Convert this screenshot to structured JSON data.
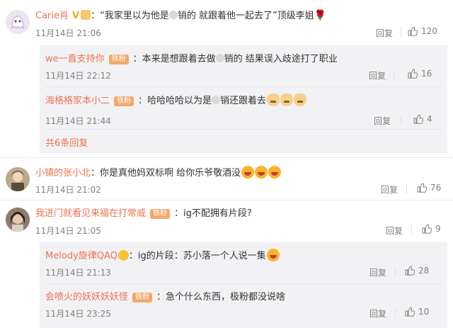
{
  "comments": [
    {
      "user": "Carie肖",
      "text_before": "：“我家里以为他是",
      "text_after": "销的 就跟着他一起去了”顶级李姐",
      "time": "11月14日 21:06",
      "reply_label": "回复",
      "likes": "120",
      "replies": [
        {
          "user": "we一直支持你",
          "badge": "铁粉",
          "text_before": "：本来是想跟着去做",
          "text_after": "销的 结果误入歧途打了职业",
          "time": "11月14日 22:12",
          "reply_label": "回复",
          "likes": "16"
        },
        {
          "user": "海格格家本小二",
          "badge": "铁粉",
          "text_before": "：哈哈哈哈以为是",
          "text_after": "销还跟着去",
          "time": "11月14日 21:44",
          "reply_label": "回复",
          "likes": "4"
        }
      ],
      "more_replies": "共6条回复"
    },
    {
      "user": "小镇的张小北",
      "text": "：你是真他妈双标啊 给你乐爷敬酒没",
      "time": "11月14日 21:02",
      "reply_label": "回复",
      "likes": "76"
    },
    {
      "user": "我进门就看见来福在打常威",
      "badge": "铁粉",
      "text": "：ig不配拥有片段?",
      "time": "11月14日 21:05",
      "reply_label": "回复",
      "likes": "9",
      "replies": [
        {
          "user": "Melody旋律QAQ",
          "text": "：ig的片段：苏小落一个人说一集",
          "time": "11月14日 21:13",
          "reply_label": "回复",
          "likes": "28"
        },
        {
          "user": "会喷火的妖妖妖妖怪",
          "badge": "铁粉",
          "text": "：急个什么东西，极粉都没说啥",
          "time": "11月14日 23:25",
          "reply_label": "回复",
          "likes": "10"
        }
      ]
    }
  ],
  "icons": {
    "thumb": "thumbs-up-icon",
    "verified": "verified-v-icon"
  },
  "colors": {
    "username": "#eb7350",
    "badge": "#f3a86b",
    "reply_bg": "#f2f2f5"
  }
}
